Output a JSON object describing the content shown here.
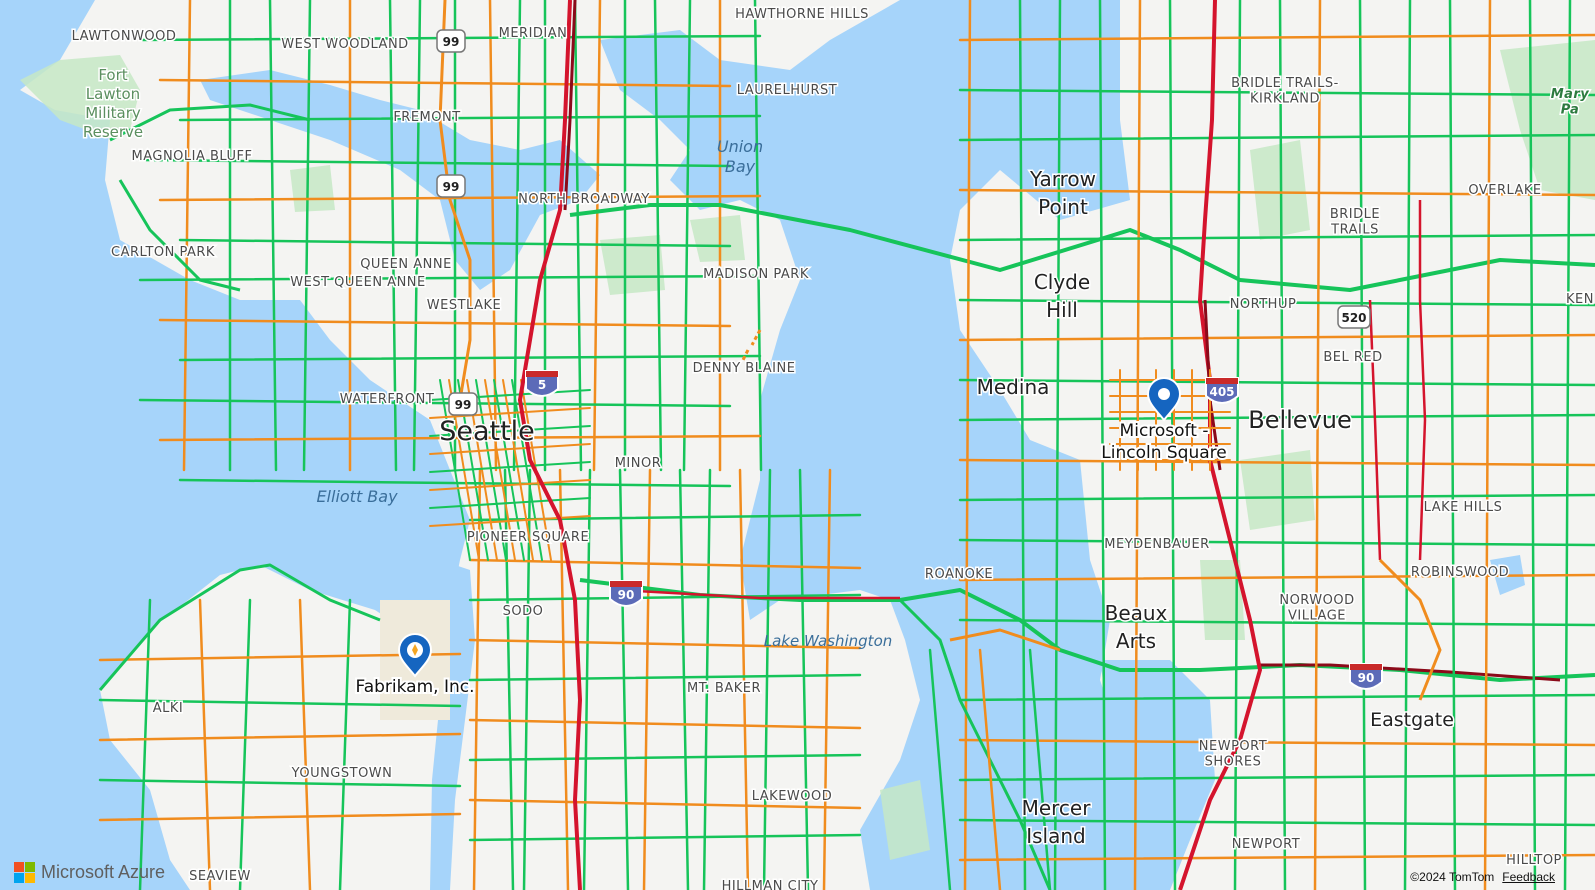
{
  "map": {
    "colors": {
      "land": "#f4f4f2",
      "water": "#a6d4fa",
      "park": "#c5e8c5",
      "traffic_free": "#16c45a",
      "traffic_moderate": "#f08c1e",
      "traffic_heavy": "#d4142d",
      "traffic_stopped": "#8b0a1a",
      "interstate_shield": "#5c6bb8",
      "pin_blue": "#1565c0"
    },
    "places": {
      "seattle": "Seattle",
      "bellevue": "Bellevue",
      "eastgate": "Eastgate",
      "medina": "Medina",
      "clyde_hill": "Clyde\nHill",
      "yarrow_point": "Yarrow\nPoint",
      "beaux_arts": "Beaux\nArts",
      "mercer_island": "Mercer\nIsland"
    },
    "water_labels": {
      "elliott_bay": "Elliott Bay",
      "lake_washington": "Lake Washington",
      "union_bay": "Union\nBay"
    },
    "neighborhoods": [
      "LAWTONWOOD",
      "WEST WOODLAND",
      "MERIDIAN",
      "HAWTHORNE HILLS",
      "LAURELHURST",
      "FREMONT",
      "MAGNOLIA BLUFF",
      "NORTH BROADWAY",
      "CARLTON PARK",
      "QUEEN ANNE",
      "WEST QUEEN ANNE",
      "WESTLAKE",
      "MADISON PARK",
      "DENNY BLAINE",
      "WATERFRONT",
      "MINOR",
      "PIONEER SQUARE",
      "SODO",
      "ROANOKE",
      "MT. BAKER",
      "ALKI",
      "YOUNGSTOWN",
      "LAKEWOOD",
      "SEAVIEW",
      "HILLMAN CITY",
      "BRIDLE TRAILS-\nKIRKLAND",
      "OVERLAKE",
      "BRIDLE\nTRAILS",
      "NORTHUP",
      "BEL RED",
      "LAKE HILLS",
      "MEYDENBAUER",
      "ROBINSWOOD",
      "NORWOOD\nVILLAGE",
      "NEWPORT\nSHORES",
      "NEWPORT",
      "HILLTOP",
      "KEN",
      "Mary\nPa"
    ],
    "park_labels": {
      "fort_lawton": "Fort\nLawton\nMilitary\nReserve"
    },
    "shields": [
      {
        "type": "state",
        "number": "99"
      },
      {
        "type": "state",
        "number": "99"
      },
      {
        "type": "state",
        "number": "99"
      },
      {
        "type": "interstate",
        "number": "5"
      },
      {
        "type": "interstate",
        "number": "90"
      },
      {
        "type": "interstate",
        "number": "90"
      },
      {
        "type": "interstate",
        "number": "405"
      },
      {
        "type": "state",
        "number": "520"
      }
    ],
    "markers": [
      {
        "label": "Microsoft -\nLincoln Square",
        "icon": "circle-pin-icon"
      },
      {
        "label": "Fabrikam, Inc.",
        "icon": "compass-pin-icon"
      }
    ]
  },
  "branding": {
    "logo_text": "Microsoft Azure",
    "logo_colors": [
      "#f25022",
      "#7fba00",
      "#00a4ef",
      "#ffb900"
    ]
  },
  "attribution": {
    "copyright": "©2024 TomTom",
    "feedback": "Feedback"
  }
}
